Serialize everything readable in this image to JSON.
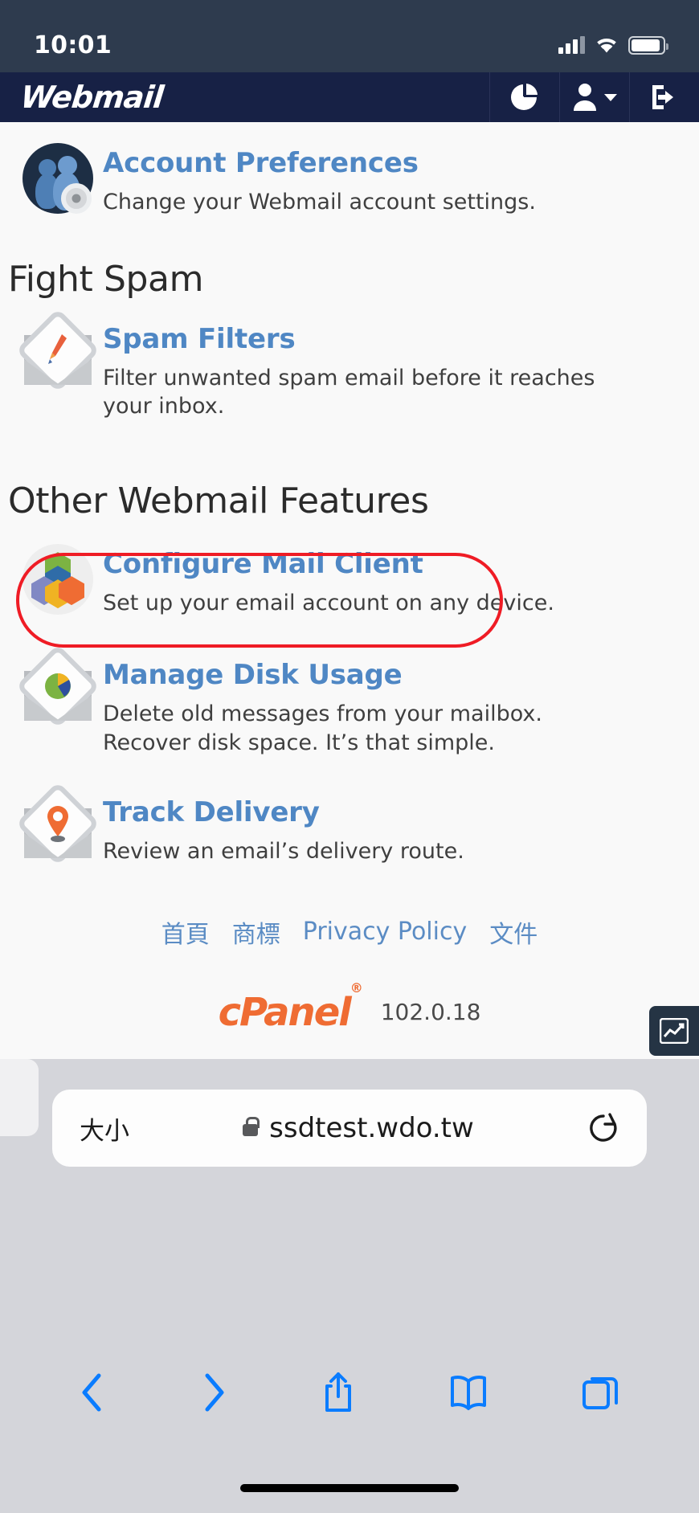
{
  "status_bar": {
    "time": "10:01",
    "signal_icon": "cellular-signal-icon",
    "wifi_icon": "wifi-icon",
    "battery_icon": "battery-icon"
  },
  "navbar": {
    "brand": "Webmail",
    "buttons": [
      {
        "name": "stats-pie-icon",
        "label": ""
      },
      {
        "name": "user-account-icon",
        "label": ""
      },
      {
        "name": "logout-icon",
        "label": ""
      }
    ]
  },
  "features_top": [
    {
      "title": "Account Preferences",
      "description": "Change your Webmail account settings.",
      "icon": "account-preferences-icon"
    }
  ],
  "sections": [
    {
      "heading": "Fight Spam",
      "items": [
        {
          "title": "Spam Filters",
          "description": "Filter unwanted spam email before it reaches your inbox.",
          "icon": "spam-filters-icon"
        }
      ]
    },
    {
      "heading": "Other Webmail Features",
      "items": [
        {
          "title": "Configure Mail Client",
          "description": "Set up your email account on any device.",
          "icon": "configure-mail-client-icon",
          "highlighted": true
        },
        {
          "title": "Manage Disk Usage",
          "description": "Delete old messages from your mailbox. Recover disk space. It’s that simple.",
          "icon": "manage-disk-usage-icon"
        },
        {
          "title": "Track Delivery",
          "description": "Review an email’s delivery route.",
          "icon": "track-delivery-icon"
        }
      ]
    }
  ],
  "footer": {
    "links": [
      "首頁",
      "商標",
      "Privacy Policy",
      "文件"
    ],
    "brand": "cPanel",
    "brand_trademark": "®",
    "version": "102.0.18"
  },
  "float_badge": {
    "icon": "chart-line-icon"
  },
  "browser": {
    "text_size_label": "大小",
    "lock_icon": "lock-icon",
    "url": "ssdtest.wdo.tw",
    "reload_icon": "reload-icon",
    "toolbar": [
      {
        "name": "back-icon"
      },
      {
        "name": "forward-icon"
      },
      {
        "name": "share-icon"
      },
      {
        "name": "bookmarks-icon"
      },
      {
        "name": "tabs-icon"
      }
    ]
  },
  "colors": {
    "status_bar_bg": "#2e3b4e",
    "navbar_bg": "#172145",
    "link_blue": "#4f87c4",
    "annotation_red": "#ef1c25",
    "cpanel_orange": "#ef6c33",
    "safari_blue": "#0a7cff"
  }
}
